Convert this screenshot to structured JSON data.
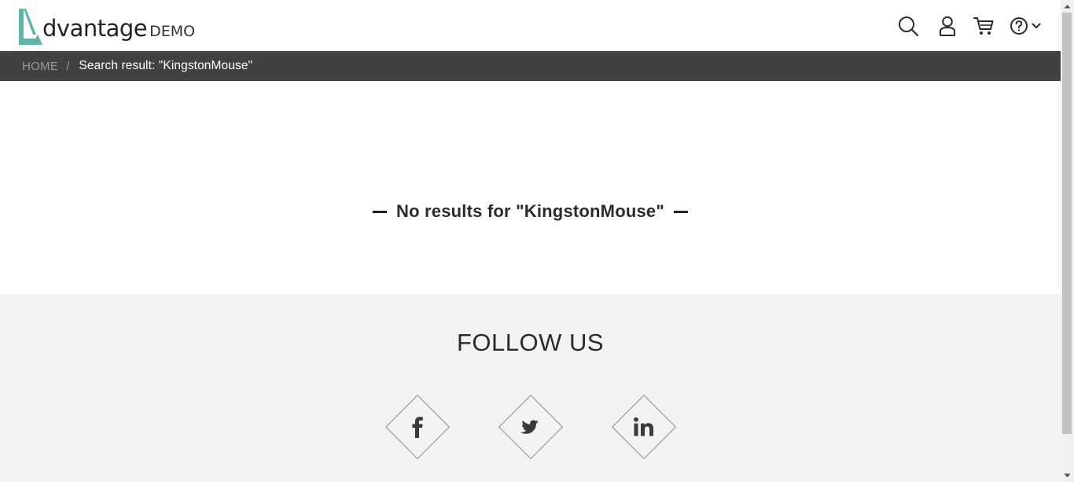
{
  "header": {
    "logo_word": "dvantage",
    "logo_demo": "DEMO",
    "icons": [
      "search-icon",
      "user-icon",
      "cart-icon",
      "help-icon",
      "chevron-down-icon"
    ]
  },
  "breadcrumb": {
    "home": "HOME",
    "separator": "/",
    "current": "Search result: \"KingstonMouse\""
  },
  "main": {
    "no_results": "No results for \"KingstonMouse\""
  },
  "footer": {
    "follow_title": "FOLLOW US",
    "social": [
      "facebook-icon",
      "twitter-icon",
      "linkedin-icon"
    ]
  },
  "colors": {
    "brand_teal": "#5bb5ab",
    "crumb_bar": "#414141",
    "footer_bg": "#f3f3f1"
  }
}
